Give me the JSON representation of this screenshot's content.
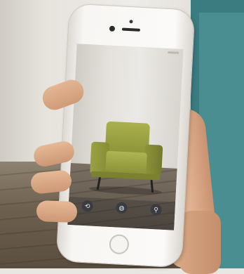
{
  "scene": {
    "description_colors": {
      "teal_panel": "#3b7c80",
      "chair_green": "#9aa144",
      "floor_wood": "#6d604f"
    }
  },
  "phone": {
    "app_toolbar": [
      {
        "icon": "rotate-icon",
        "glyph": "⟲",
        "label": ""
      },
      {
        "icon": "globe-icon",
        "glyph": "◍",
        "label": ""
      },
      {
        "icon": "share-icon",
        "glyph": "⚲",
        "label": ""
      }
    ]
  }
}
